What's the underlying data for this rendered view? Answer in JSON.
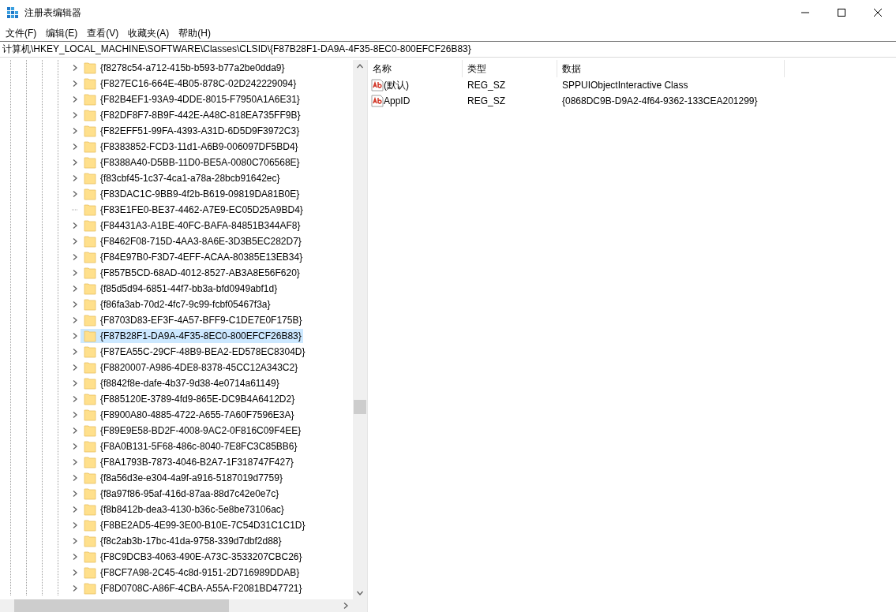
{
  "window": {
    "title": "注册表编辑器"
  },
  "menu": [
    "文件(F)",
    "编辑(E)",
    "查看(V)",
    "收藏夹(A)",
    "帮助(H)"
  ],
  "address": "计算机\\HKEY_LOCAL_MACHINE\\SOFTWARE\\Classes\\CLSID\\{F87B28F1-DA9A-4F35-8EC0-800EFCF26B83}",
  "tree": [
    {
      "label": "{f8278c54-a712-415b-b593-b77a2be0dda9}",
      "expandable": true,
      "selected": false
    },
    {
      "label": "{F827EC16-664E-4B05-878C-02D242229094}",
      "expandable": true,
      "selected": false
    },
    {
      "label": "{F82B4EF1-93A9-4DDE-8015-F7950A1A6E31}",
      "expandable": true,
      "selected": false
    },
    {
      "label": "{F82DF8F7-8B9F-442E-A48C-818EA735FF9B}",
      "expandable": true,
      "selected": false
    },
    {
      "label": "{F82EFF51-99FA-4393-A31D-6D5D9F3972C3}",
      "expandable": true,
      "selected": false
    },
    {
      "label": "{F8383852-FCD3-11d1-A6B9-006097DF5BD4}",
      "expandable": true,
      "selected": false
    },
    {
      "label": "{F8388A40-D5BB-11D0-BE5A-0080C706568E}",
      "expandable": true,
      "selected": false
    },
    {
      "label": "{f83cbf45-1c37-4ca1-a78a-28bcb91642ec}",
      "expandable": true,
      "selected": false
    },
    {
      "label": "{F83DAC1C-9BB9-4f2b-B619-09819DA81B0E}",
      "expandable": true,
      "selected": false
    },
    {
      "label": "{F83E1FE0-BE37-4462-A7E9-EC05D25A9BD4}",
      "expandable": false,
      "selected": false
    },
    {
      "label": "{F84431A3-A1BE-40FC-BAFA-84851B344AF8}",
      "expandable": true,
      "selected": false
    },
    {
      "label": "{F8462F08-715D-4AA3-8A6E-3D3B5EC282D7}",
      "expandable": true,
      "selected": false
    },
    {
      "label": "{F84E97B0-F3D7-4EFF-ACAA-80385E13EB34}",
      "expandable": true,
      "selected": false
    },
    {
      "label": "{F857B5CD-68AD-4012-8527-AB3A8E56F620}",
      "expandable": true,
      "selected": false
    },
    {
      "label": "{f85d5d94-6851-44f7-bb3a-bfd0949abf1d}",
      "expandable": true,
      "selected": false
    },
    {
      "label": "{f86fa3ab-70d2-4fc7-9c99-fcbf05467f3a}",
      "expandable": true,
      "selected": false
    },
    {
      "label": "{F8703D83-EF3F-4A57-BFF9-C1DE7E0F175B}",
      "expandable": true,
      "selected": false
    },
    {
      "label": "{F87B28F1-DA9A-4F35-8EC0-800EFCF26B83}",
      "expandable": true,
      "selected": true
    },
    {
      "label": "{F87EA55C-29CF-48B9-BEA2-ED578EC8304D}",
      "expandable": true,
      "selected": false
    },
    {
      "label": "{F8820007-A986-4DE8-8378-45CC12A343C2}",
      "expandable": true,
      "selected": false
    },
    {
      "label": "{f8842f8e-dafe-4b37-9d38-4e0714a61149}",
      "expandable": true,
      "selected": false
    },
    {
      "label": "{F885120E-3789-4fd9-865E-DC9B4A6412D2}",
      "expandable": true,
      "selected": false
    },
    {
      "label": "{F8900A80-4885-4722-A655-7A60F7596E3A}",
      "expandable": true,
      "selected": false
    },
    {
      "label": "{F89E9E58-BD2F-4008-9AC2-0F816C09F4EE}",
      "expandable": true,
      "selected": false
    },
    {
      "label": "{F8A0B131-5F68-486c-8040-7E8FC3C85BB6}",
      "expandable": true,
      "selected": false
    },
    {
      "label": "{F8A1793B-7873-4046-B2A7-1F318747F427}",
      "expandable": true,
      "selected": false
    },
    {
      "label": "{f8a56d3e-e304-4a9f-a916-5187019d7759}",
      "expandable": true,
      "selected": false
    },
    {
      "label": "{f8a97f86-95af-416d-87aa-88d7c42e0e7c}",
      "expandable": true,
      "selected": false
    },
    {
      "label": "{f8b8412b-dea3-4130-b36c-5e8be73106ac}",
      "expandable": true,
      "selected": false
    },
    {
      "label": "{F8BE2AD5-4E99-3E00-B10E-7C54D31C1C1D}",
      "expandable": true,
      "selected": false
    },
    {
      "label": "{f8c2ab3b-17bc-41da-9758-339d7dbf2d88}",
      "expandable": true,
      "selected": false
    },
    {
      "label": "{F8C9DCB3-4063-490E-A73C-3533207CBC26}",
      "expandable": true,
      "selected": false
    },
    {
      "label": "{F8CF7A98-2C45-4c8d-9151-2D716989DDAB}",
      "expandable": true,
      "selected": false
    },
    {
      "label": "{F8D0708C-A86F-4CBA-A55A-F2081BD47721}",
      "expandable": true,
      "selected": false
    }
  ],
  "values": {
    "columns": [
      "名称",
      "类型",
      "数据"
    ],
    "rows": [
      {
        "name": "(默认)",
        "type": "REG_SZ",
        "data": "SPPUIObjectInteractive Class"
      },
      {
        "name": "AppID",
        "type": "REG_SZ",
        "data": "{0868DC9B-D9A2-4f64-9362-133CEA201299}"
      }
    ]
  }
}
